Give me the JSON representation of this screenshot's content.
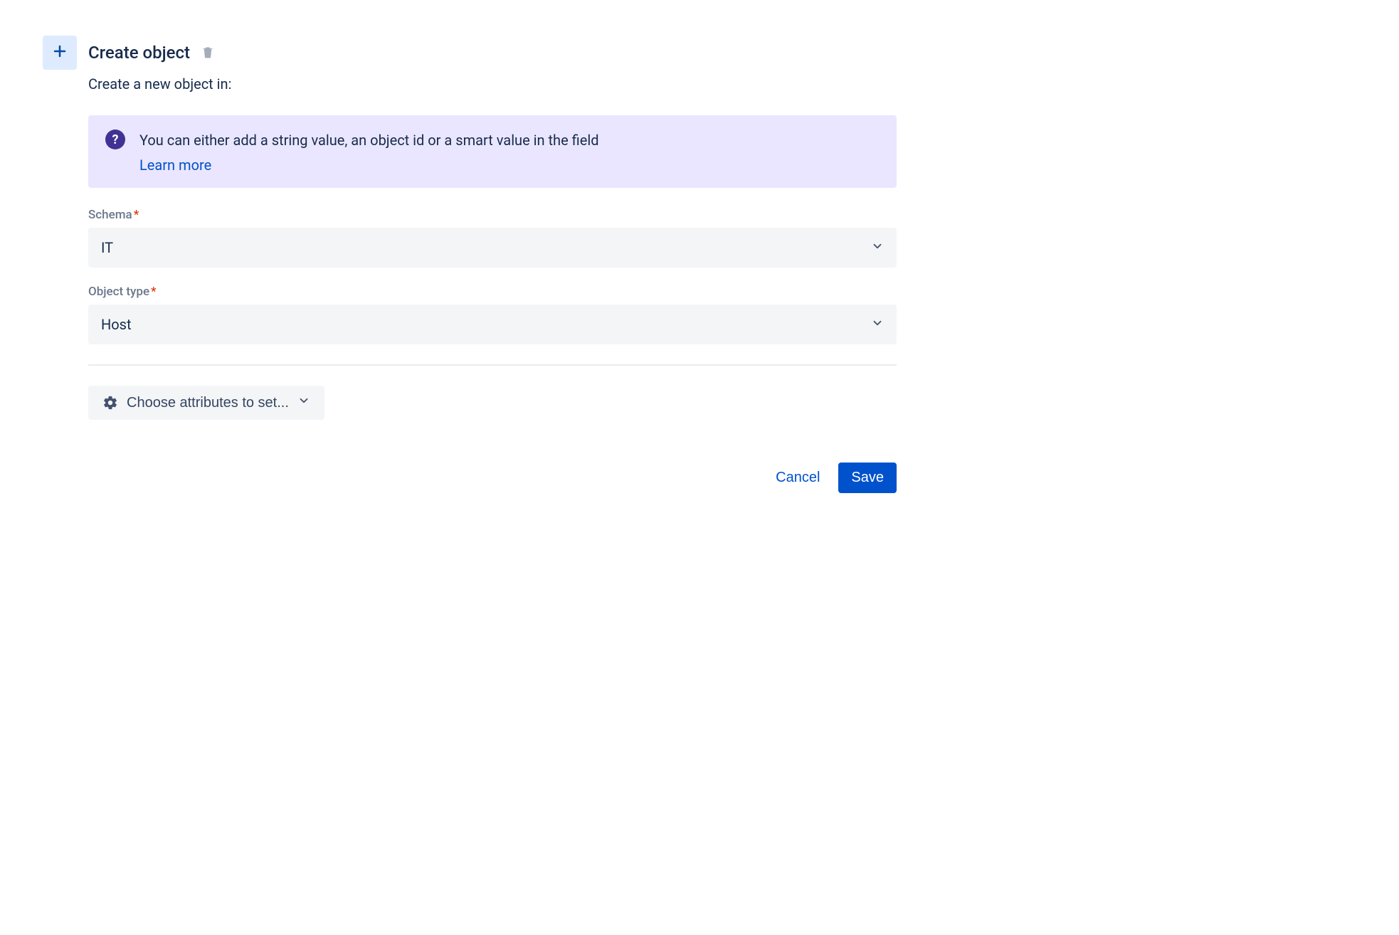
{
  "header": {
    "title": "Create object",
    "subtitle": "Create a new object in:"
  },
  "info_banner": {
    "text": "You can either add a string value, an object id or a smart value in the field",
    "link_label": "Learn more"
  },
  "fields": {
    "schema": {
      "label": "Schema",
      "value": "IT"
    },
    "object_type": {
      "label": "Object type",
      "value": "Host"
    }
  },
  "attributes_button": {
    "label": "Choose attributes to set..."
  },
  "actions": {
    "cancel": "Cancel",
    "save": "Save"
  }
}
